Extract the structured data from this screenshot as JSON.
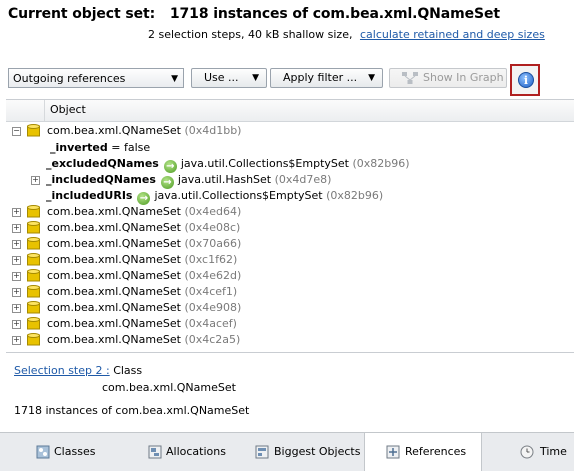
{
  "header": {
    "title_label": "Current object set:",
    "title_value": "1718 instances of com.bea.xml.QNameSet",
    "summary": "2 selection steps, 40 kB shallow size,",
    "link": "calculate retained and deep sizes"
  },
  "toolbar": {
    "view_select": "Outgoing references",
    "use_button": "Use ...",
    "apply_filter_button": "Apply filter ...",
    "show_in_graph_button": "Show In Graph",
    "info_glyph": "i"
  },
  "tree": {
    "column_header": "Object",
    "root": {
      "name": "com.bea.xml.QNameSet",
      "addr": "(0x4d1bb)",
      "fields": [
        {
          "name": "_inverted",
          "value": "= false"
        },
        {
          "name": "_excludedQNames",
          "class": "java.util.Collections$EmptySet",
          "addr": "(0x82b96)"
        },
        {
          "name": "_includedQNames",
          "class": "java.util.HashSet",
          "addr": "(0x4d7e8)"
        },
        {
          "name": "_includedURIs",
          "class": "java.util.Collections$EmptySet",
          "addr": "(0x82b96)"
        }
      ]
    },
    "siblings": [
      {
        "name": "com.bea.xml.QNameSet",
        "addr": "(0x4ed64)"
      },
      {
        "name": "com.bea.xml.QNameSet",
        "addr": "(0x4e08c)"
      },
      {
        "name": "com.bea.xml.QNameSet",
        "addr": "(0x70a66)"
      },
      {
        "name": "com.bea.xml.QNameSet",
        "addr": "(0xc1f62)"
      },
      {
        "name": "com.bea.xml.QNameSet",
        "addr": "(0x4e62d)"
      },
      {
        "name": "com.bea.xml.QNameSet",
        "addr": "(0x4cef1)"
      },
      {
        "name": "com.bea.xml.QNameSet",
        "addr": "(0x4e908)"
      },
      {
        "name": "com.bea.xml.QNameSet",
        "addr": "(0x4acef)"
      },
      {
        "name": "com.bea.xml.QNameSet",
        "addr": "(0x4c2a5)"
      }
    ]
  },
  "details": {
    "step_link": "Selection step 2 :",
    "step_kind": "Class",
    "class_name": "com.bea.xml.QNameSet",
    "summary": "1718 instances of com.bea.xml.QNameSet"
  },
  "tabs": [
    "Classes",
    "Allocations",
    "Biggest Objects",
    "References",
    "Time"
  ],
  "active_tab": "References",
  "colors": {
    "accent_link": "#1f5aa8",
    "highlight_border": "#b02020",
    "object_icon": "#e8c200"
  }
}
